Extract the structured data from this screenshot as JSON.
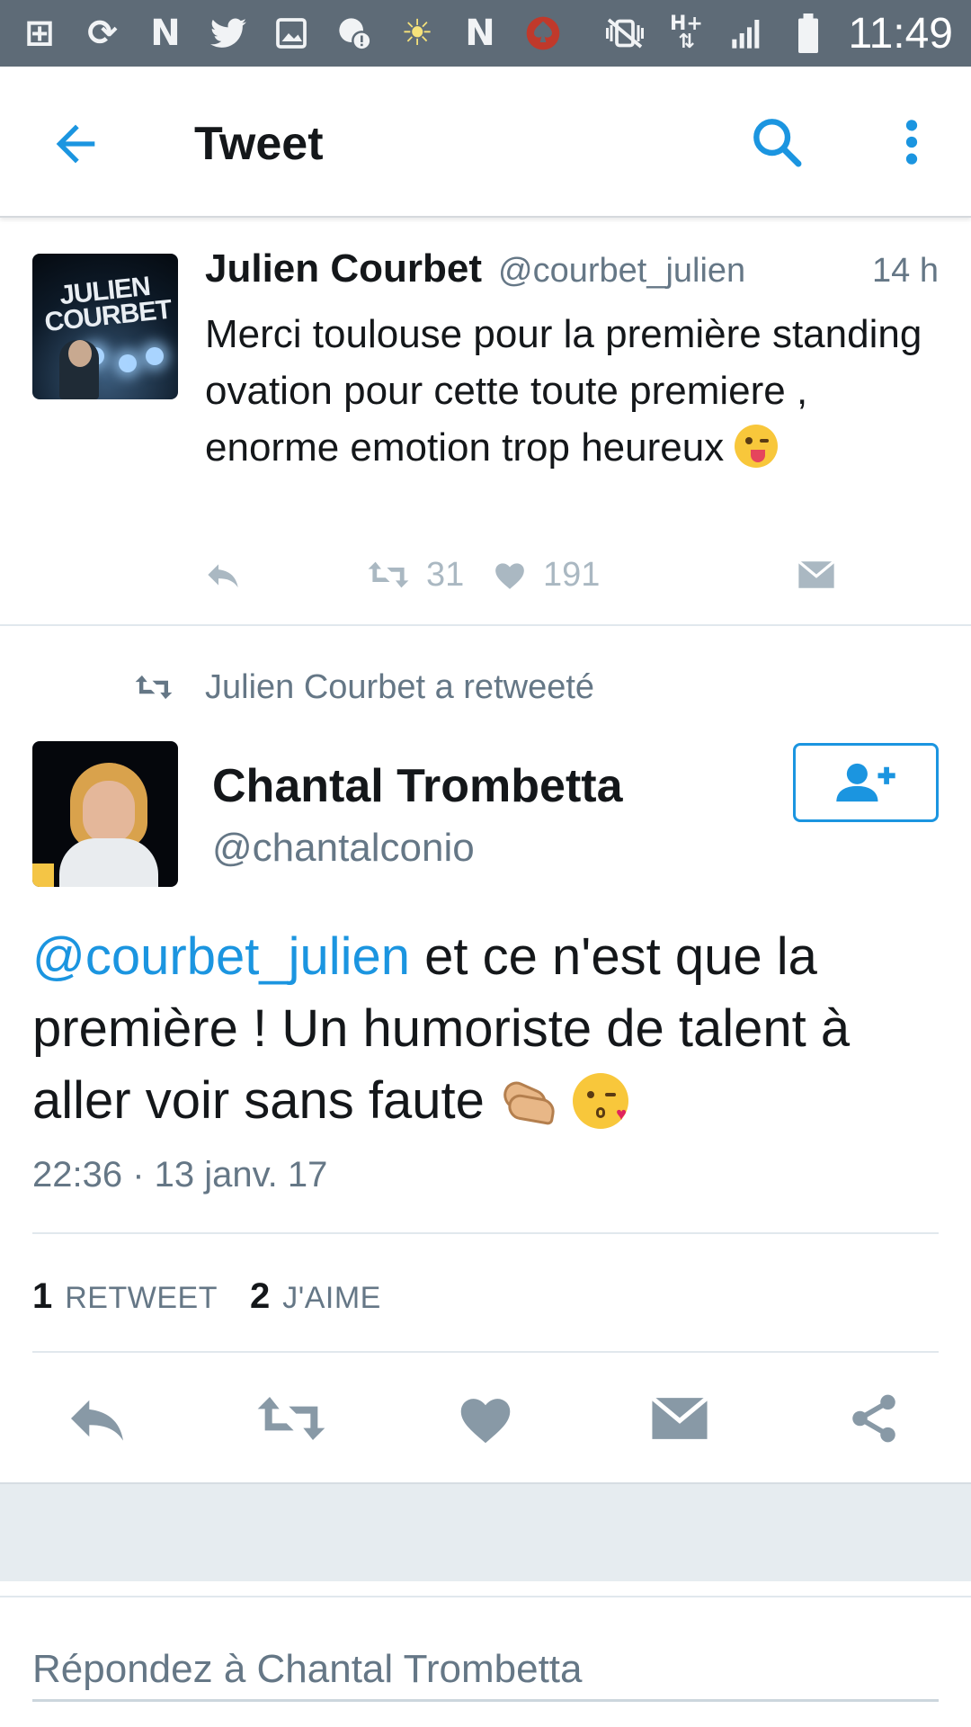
{
  "status_bar": {
    "time": "11:49",
    "left_icons": [
      "add-box-icon",
      "sync-icon",
      "netflix-n-icon",
      "twitter-bird-icon",
      "image-icon",
      "alert-bubble-icon",
      "brightness-icon",
      "netflix-n-icon",
      "poker-spade-icon"
    ],
    "right_icons": [
      "vibrate-mute-icon",
      "network-h-plus-icon",
      "signal-icon",
      "battery-icon"
    ],
    "left_glyphs": [
      "⊞",
      "⟳",
      "N",
      "🐦",
      "▣",
      "●",
      "☀",
      "N",
      "♠"
    ],
    "network_label": "H+"
  },
  "app_bar": {
    "title": "Tweet"
  },
  "parent_tweet": {
    "name": "Julien Courbet",
    "handle": "@courbet_julien",
    "time": "14 h",
    "text": "Merci toulouse pour la première standing ovation pour cette toute premiere , enorme emotion trop heureux ",
    "avatar_text": "JULIEN COURBET",
    "retweets": "31",
    "likes": "191"
  },
  "retweet_label": "Julien Courbet a retweeté",
  "main_tweet": {
    "name": "Chantal Trombetta",
    "handle": "@chantalconio",
    "mention": "@courbet_julien",
    "text": " et ce n'est que la première ! Un humoriste de talent à aller voir sans faute ",
    "date": "22:36 · 13 janv. 17",
    "retweet_count": "1",
    "retweet_label": "RETWEET",
    "like_count": "2",
    "like_label": "J'AIME"
  },
  "reply": {
    "placeholder": "Répondez à Chantal Trombetta"
  },
  "colors": {
    "status_bar": "#5e6b77",
    "accent": "#1b95e0",
    "muted": "#657786",
    "icon_grey": "#8899a6",
    "light_icon": "#aab8c2",
    "band": "#e6ecf0"
  }
}
